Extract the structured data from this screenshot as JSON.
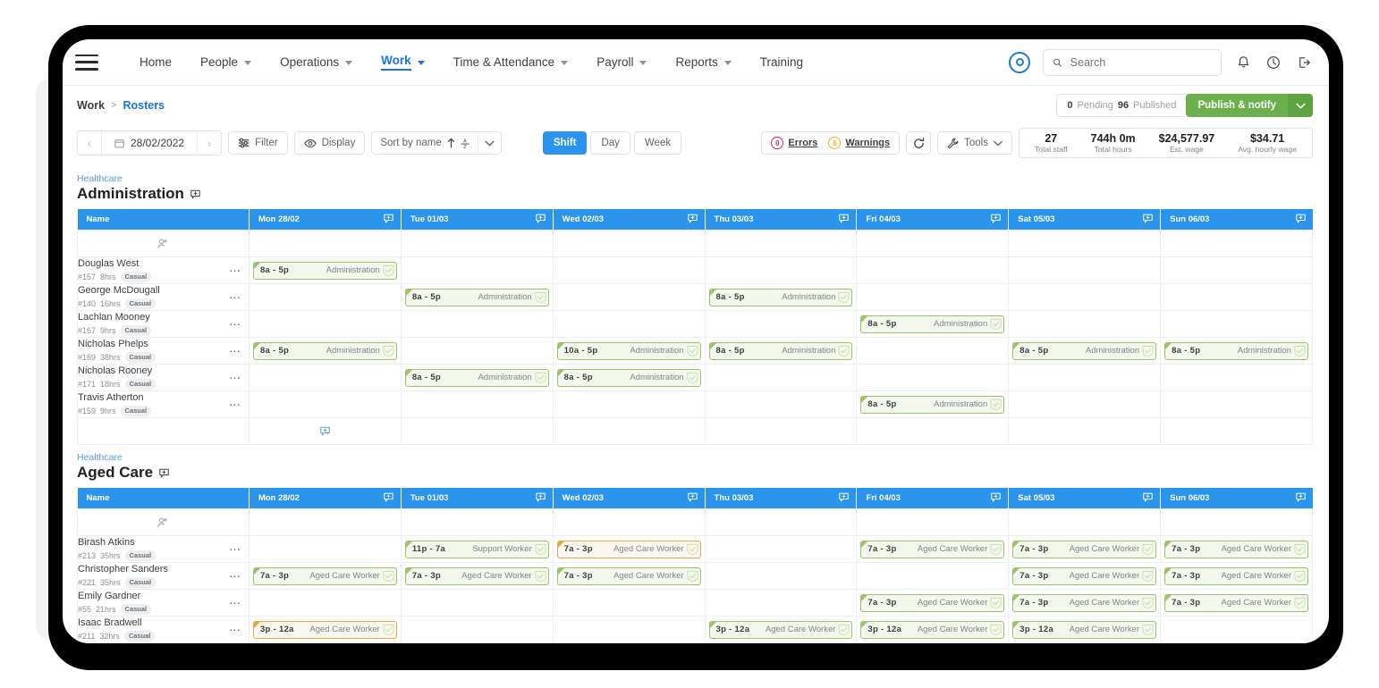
{
  "nav": {
    "menu_icon": "hamburger-icon",
    "items": [
      {
        "label": "Home",
        "has_caret": false,
        "active": false
      },
      {
        "label": "People",
        "has_caret": true,
        "active": false
      },
      {
        "label": "Operations",
        "has_caret": true,
        "active": false
      },
      {
        "label": "Work",
        "has_caret": true,
        "active": true
      },
      {
        "label": "Time & Attendance",
        "has_caret": true,
        "active": false
      },
      {
        "label": "Payroll",
        "has_caret": true,
        "active": false
      },
      {
        "label": "Reports",
        "has_caret": true,
        "active": false
      },
      {
        "label": "Training",
        "has_caret": false,
        "active": false
      }
    ],
    "brand_icon": "target-logo-icon",
    "search": {
      "value": "",
      "placeholder": "Search",
      "icon": "search-icon"
    },
    "notifications_icon": "bell-icon",
    "help_icon": "help-circle-icon",
    "logout_icon": "logout-icon"
  },
  "breadcrumb": {
    "parent": "Work",
    "separator": ">",
    "current": "Rosters"
  },
  "publish": {
    "pending_count": "0",
    "pending_label": "Pending",
    "published_count": "96",
    "published_label": "Published",
    "button_label": "Publish & notify",
    "caret_icon": "chevron-down-icon"
  },
  "toolbar": {
    "prev_icon": "chevron-left-icon",
    "next_icon": "chevron-right-icon",
    "date_value": "28/02/2022",
    "calendar_icon": "calendar-icon",
    "filter_label": "Filter",
    "filter_icon": "filter-icon",
    "display_label": "Display",
    "display_icon": "eye-icon",
    "sort_label": "Sort by name",
    "sort_asc_icon": "arrow-up-icon",
    "sort_az_icon": "sort-az-icon",
    "sort_caret_icon": "chevron-down-icon",
    "views": [
      {
        "label": "Shift",
        "active": true
      },
      {
        "label": "Day",
        "active": false
      },
      {
        "label": "Week",
        "active": false
      }
    ],
    "errors_count": "0",
    "errors_label": "Errors",
    "warnings_count": "6",
    "warnings_label": "Warnings",
    "refresh_icon": "refresh-icon",
    "tools_label": "Tools",
    "tools_icon": "wrench-icon",
    "tools_caret_icon": "chevron-down-icon",
    "stats": [
      {
        "value": "27",
        "label": "Total staff"
      },
      {
        "value": "744h 0m",
        "label": "Total hours"
      },
      {
        "value": "$24,577.97",
        "label": "Est. wage"
      },
      {
        "value": "$34.71",
        "label": "Avg. hourly wage"
      }
    ]
  },
  "colors": {
    "accent_blue": "#2b94ed",
    "link_blue": "#1a73e8",
    "publish_green": "#6cb04e",
    "chip_green_border": "#9bc46a",
    "chip_green_bg": "#f4f7ec",
    "chip_orange_border": "#eea540",
    "error_red": "#e0245e",
    "warning_yellow": "#f0b429"
  },
  "columns": [
    "Name",
    "Mon 28/02",
    "Tue 01/03",
    "Wed 02/03",
    "Thu 03/03",
    "Fri 04/03",
    "Sat 05/03",
    "Sun 06/03"
  ],
  "add_shift_icon": "add-shift-icon",
  "add_person_icon": "add-person-icon",
  "groups": [
    {
      "subtitle": "Healthcare",
      "title": "Administration",
      "title_add_icon": "add-shift-icon",
      "rows": [
        {
          "name": "Douglas West",
          "id": "#157",
          "hours": "8hrs",
          "type": "Casual",
          "shifts": [
            {
              "time": "8a - 5p",
              "role": "Administration",
              "state": "published"
            },
            null,
            null,
            null,
            null,
            null,
            null
          ]
        },
        {
          "name": "George McDougall",
          "id": "#140",
          "hours": "16hrs",
          "type": "Casual",
          "shifts": [
            null,
            {
              "time": "8a - 5p",
              "role": "Administration",
              "state": "published"
            },
            null,
            {
              "time": "8a - 5p",
              "role": "Administration",
              "state": "published"
            },
            null,
            null,
            null
          ]
        },
        {
          "name": "Lachlan Mooney",
          "id": "#167",
          "hours": "9hrs",
          "type": "Casual",
          "shifts": [
            null,
            null,
            null,
            null,
            {
              "time": "8a - 5p",
              "role": "Administration",
              "state": "published"
            },
            null,
            null
          ]
        },
        {
          "name": "Nicholas Phelps",
          "id": "#169",
          "hours": "38hrs",
          "type": "Casual",
          "shifts": [
            {
              "time": "8a - 5p",
              "role": "Administration",
              "state": "published"
            },
            null,
            {
              "time": "10a - 5p",
              "role": "Administration",
              "state": "published"
            },
            {
              "time": "8a - 5p",
              "role": "Administration",
              "state": "published"
            },
            null,
            {
              "time": "8a - 5p",
              "role": "Administration",
              "state": "published"
            },
            {
              "time": "8a - 5p",
              "role": "Administration",
              "state": "published"
            }
          ]
        },
        {
          "name": "Nicholas Rooney",
          "id": "#171",
          "hours": "18hrs",
          "type": "Casual",
          "shifts": [
            null,
            {
              "time": "8a - 5p",
              "role": "Administration",
              "state": "published"
            },
            {
              "time": "8a - 5p",
              "role": "Administration",
              "state": "published"
            },
            null,
            null,
            null,
            null
          ]
        },
        {
          "name": "Travis Atherton",
          "id": "#159",
          "hours": "9hrs",
          "type": "Casual",
          "shifts": [
            null,
            null,
            null,
            null,
            {
              "time": "8a - 5p",
              "role": "Administration",
              "state": "published"
            },
            null,
            null
          ]
        }
      ]
    },
    {
      "subtitle": "Healthcare",
      "title": "Aged Care",
      "title_add_icon": "add-shift-icon",
      "rows": [
        {
          "name": "Birash Atkins",
          "id": "#213",
          "hours": "35hrs",
          "type": "Casual",
          "shifts": [
            null,
            {
              "time": "11p - 7a",
              "role": "Support Worker",
              "state": "published"
            },
            {
              "time": "7a - 3p",
              "role": "Aged Care Worker",
              "state": "unpublished"
            },
            null,
            {
              "time": "7a - 3p",
              "role": "Aged Care Worker",
              "state": "published"
            },
            {
              "time": "7a - 3p",
              "role": "Aged Care Worker",
              "state": "published"
            },
            {
              "time": "7a - 3p",
              "role": "Aged Care Worker",
              "state": "published"
            }
          ]
        },
        {
          "name": "Christopher Sanders",
          "id": "#221",
          "hours": "35hrs",
          "type": "Casual",
          "shifts": [
            {
              "time": "7a - 3p",
              "role": "Aged Care Worker",
              "state": "published"
            },
            {
              "time": "7a - 3p",
              "role": "Aged Care Worker",
              "state": "published"
            },
            {
              "time": "7a - 3p",
              "role": "Aged Care Worker",
              "state": "published"
            },
            null,
            null,
            {
              "time": "7a - 3p",
              "role": "Aged Care Worker",
              "state": "published"
            },
            {
              "time": "7a - 3p",
              "role": "Aged Care Worker",
              "state": "published"
            }
          ]
        },
        {
          "name": "Emily Gardner",
          "id": "#55",
          "hours": "21hrs",
          "type": "Casual",
          "shifts": [
            null,
            null,
            null,
            null,
            {
              "time": "7a - 3p",
              "role": "Aged Care Worker",
              "state": "published"
            },
            {
              "time": "7a - 3p",
              "role": "Aged Care Worker",
              "state": "published"
            },
            {
              "time": "7a - 3p",
              "role": "Aged Care Worker",
              "state": "published"
            }
          ]
        },
        {
          "name": "Isaac Bradwell",
          "id": "#211",
          "hours": "32hrs",
          "type": "Casual",
          "shifts": [
            {
              "time": "3p - 12a",
              "role": "Aged Care Worker",
              "state": "unpublished"
            },
            null,
            null,
            {
              "time": "3p - 12a",
              "role": "Aged Care Worker",
              "state": "published"
            },
            {
              "time": "3p - 12a",
              "role": "Aged Care Worker",
              "state": "published"
            },
            {
              "time": "3p - 12a",
              "role": "Aged Care Worker",
              "state": "published"
            },
            null
          ]
        }
      ]
    }
  ]
}
